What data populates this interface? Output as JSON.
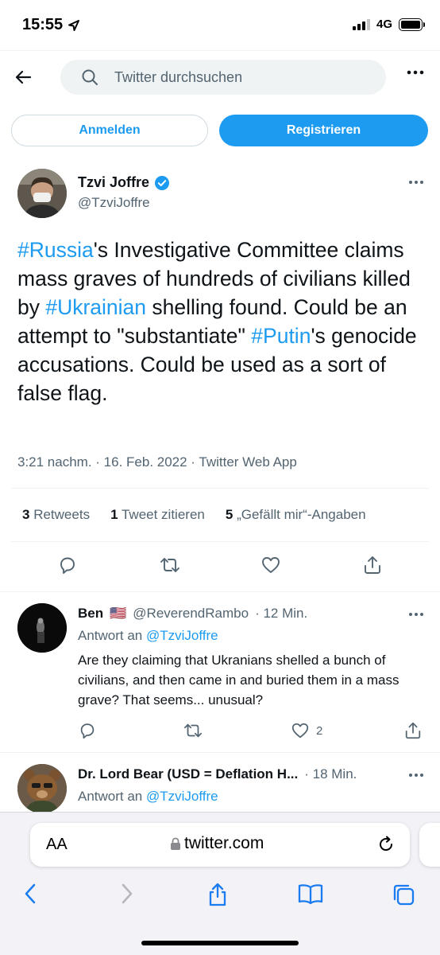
{
  "status_bar": {
    "time": "15:55",
    "network": "4G"
  },
  "search": {
    "placeholder": "Twitter durchsuchen"
  },
  "auth": {
    "login_label": "Anmelden",
    "signup_label": "Registrieren"
  },
  "main_tweet": {
    "author_name": "Tzvi Joffre",
    "handle": "@TzviJoffre",
    "text_segments": [
      {
        "text": "#Russia",
        "tag": true
      },
      {
        "text": "'s Investigative Committee claims mass graves of hundreds of civilians killed by ",
        "tag": false
      },
      {
        "text": "#Ukrainian",
        "tag": true
      },
      {
        "text": " shelling found. Could be an attempt to \"substantiate\" ",
        "tag": false
      },
      {
        "text": "#Putin",
        "tag": true
      },
      {
        "text": "'s genocide accusations. Could be used as a sort of false flag.",
        "tag": false
      }
    ],
    "meta": "3:21 nachm. · 16. Feb. 2022 · Twitter Web App",
    "stats": {
      "retweets_count": "3",
      "retweets_label": "Retweets",
      "quotes_count": "1",
      "quotes_label": "Tweet zitieren",
      "likes_count": "5",
      "likes_label": "„Gefällt mir“-Angaben"
    }
  },
  "replies": [
    {
      "author_name": "Ben",
      "flag": "🇺🇸",
      "handle": "@ReverendRambo",
      "time": "· 12 Min.",
      "reply_to_label": "Antwort an",
      "reply_to_handle": "@TzviJoffre",
      "text": "Are they claiming that Ukranians shelled a bunch of civilians, and then came in and buried them in a mass grave? That seems... unusual?",
      "likes": "2"
    },
    {
      "author_name": "Dr. Lord Bear (USD = Deflation H...",
      "time": "· 18 Min.",
      "reply_to_label": "Antwort an",
      "reply_to_handle": "@TzviJoffre"
    }
  ],
  "browser": {
    "text_size_label": "AA",
    "url": "twitter.com"
  },
  "colors": {
    "accent": "#1d9bf0",
    "secondary_text": "#536471",
    "primary_text": "#0f1419",
    "divider": "#eff3f4"
  }
}
